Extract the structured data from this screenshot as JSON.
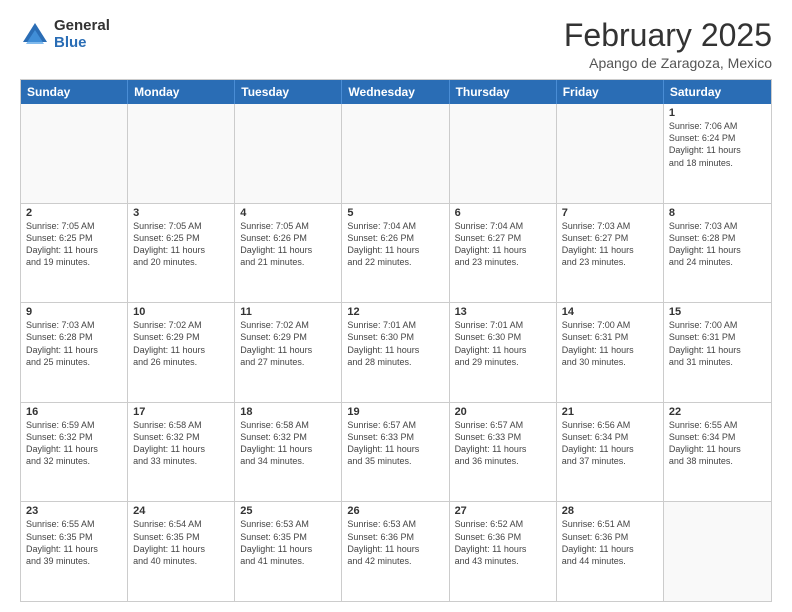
{
  "logo": {
    "general": "General",
    "blue": "Blue"
  },
  "title": {
    "month": "February 2025",
    "location": "Apango de Zaragoza, Mexico"
  },
  "header_days": [
    "Sunday",
    "Monday",
    "Tuesday",
    "Wednesday",
    "Thursday",
    "Friday",
    "Saturday"
  ],
  "weeks": [
    [
      {
        "day": "",
        "info": ""
      },
      {
        "day": "",
        "info": ""
      },
      {
        "day": "",
        "info": ""
      },
      {
        "day": "",
        "info": ""
      },
      {
        "day": "",
        "info": ""
      },
      {
        "day": "",
        "info": ""
      },
      {
        "day": "1",
        "info": "Sunrise: 7:06 AM\nSunset: 6:24 PM\nDaylight: 11 hours\nand 18 minutes."
      }
    ],
    [
      {
        "day": "2",
        "info": "Sunrise: 7:05 AM\nSunset: 6:25 PM\nDaylight: 11 hours\nand 19 minutes."
      },
      {
        "day": "3",
        "info": "Sunrise: 7:05 AM\nSunset: 6:25 PM\nDaylight: 11 hours\nand 20 minutes."
      },
      {
        "day": "4",
        "info": "Sunrise: 7:05 AM\nSunset: 6:26 PM\nDaylight: 11 hours\nand 21 minutes."
      },
      {
        "day": "5",
        "info": "Sunrise: 7:04 AM\nSunset: 6:26 PM\nDaylight: 11 hours\nand 22 minutes."
      },
      {
        "day": "6",
        "info": "Sunrise: 7:04 AM\nSunset: 6:27 PM\nDaylight: 11 hours\nand 23 minutes."
      },
      {
        "day": "7",
        "info": "Sunrise: 7:03 AM\nSunset: 6:27 PM\nDaylight: 11 hours\nand 23 minutes."
      },
      {
        "day": "8",
        "info": "Sunrise: 7:03 AM\nSunset: 6:28 PM\nDaylight: 11 hours\nand 24 minutes."
      }
    ],
    [
      {
        "day": "9",
        "info": "Sunrise: 7:03 AM\nSunset: 6:28 PM\nDaylight: 11 hours\nand 25 minutes."
      },
      {
        "day": "10",
        "info": "Sunrise: 7:02 AM\nSunset: 6:29 PM\nDaylight: 11 hours\nand 26 minutes."
      },
      {
        "day": "11",
        "info": "Sunrise: 7:02 AM\nSunset: 6:29 PM\nDaylight: 11 hours\nand 27 minutes."
      },
      {
        "day": "12",
        "info": "Sunrise: 7:01 AM\nSunset: 6:30 PM\nDaylight: 11 hours\nand 28 minutes."
      },
      {
        "day": "13",
        "info": "Sunrise: 7:01 AM\nSunset: 6:30 PM\nDaylight: 11 hours\nand 29 minutes."
      },
      {
        "day": "14",
        "info": "Sunrise: 7:00 AM\nSunset: 6:31 PM\nDaylight: 11 hours\nand 30 minutes."
      },
      {
        "day": "15",
        "info": "Sunrise: 7:00 AM\nSunset: 6:31 PM\nDaylight: 11 hours\nand 31 minutes."
      }
    ],
    [
      {
        "day": "16",
        "info": "Sunrise: 6:59 AM\nSunset: 6:32 PM\nDaylight: 11 hours\nand 32 minutes."
      },
      {
        "day": "17",
        "info": "Sunrise: 6:58 AM\nSunset: 6:32 PM\nDaylight: 11 hours\nand 33 minutes."
      },
      {
        "day": "18",
        "info": "Sunrise: 6:58 AM\nSunset: 6:32 PM\nDaylight: 11 hours\nand 34 minutes."
      },
      {
        "day": "19",
        "info": "Sunrise: 6:57 AM\nSunset: 6:33 PM\nDaylight: 11 hours\nand 35 minutes."
      },
      {
        "day": "20",
        "info": "Sunrise: 6:57 AM\nSunset: 6:33 PM\nDaylight: 11 hours\nand 36 minutes."
      },
      {
        "day": "21",
        "info": "Sunrise: 6:56 AM\nSunset: 6:34 PM\nDaylight: 11 hours\nand 37 minutes."
      },
      {
        "day": "22",
        "info": "Sunrise: 6:55 AM\nSunset: 6:34 PM\nDaylight: 11 hours\nand 38 minutes."
      }
    ],
    [
      {
        "day": "23",
        "info": "Sunrise: 6:55 AM\nSunset: 6:35 PM\nDaylight: 11 hours\nand 39 minutes."
      },
      {
        "day": "24",
        "info": "Sunrise: 6:54 AM\nSunset: 6:35 PM\nDaylight: 11 hours\nand 40 minutes."
      },
      {
        "day": "25",
        "info": "Sunrise: 6:53 AM\nSunset: 6:35 PM\nDaylight: 11 hours\nand 41 minutes."
      },
      {
        "day": "26",
        "info": "Sunrise: 6:53 AM\nSunset: 6:36 PM\nDaylight: 11 hours\nand 42 minutes."
      },
      {
        "day": "27",
        "info": "Sunrise: 6:52 AM\nSunset: 6:36 PM\nDaylight: 11 hours\nand 43 minutes."
      },
      {
        "day": "28",
        "info": "Sunrise: 6:51 AM\nSunset: 6:36 PM\nDaylight: 11 hours\nand 44 minutes."
      },
      {
        "day": "",
        "info": ""
      }
    ]
  ]
}
